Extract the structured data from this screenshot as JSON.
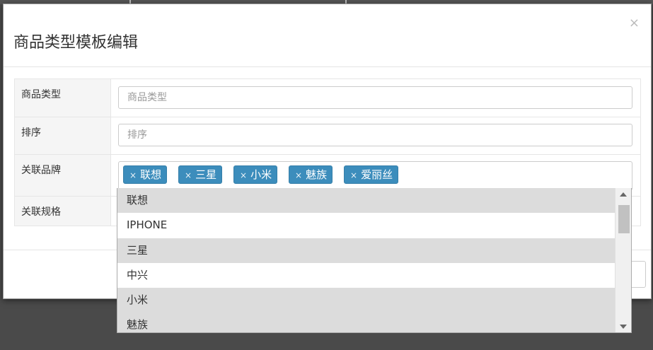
{
  "modal": {
    "title": "商品类型模板编辑",
    "close_icon": "×"
  },
  "form": {
    "type_label": "商品类型",
    "type_placeholder": "商品类型",
    "sort_label": "排序",
    "sort_placeholder": "排序",
    "brand_label": "关联品牌",
    "spec_label": "关联规格"
  },
  "brand_tags": [
    {
      "remove": "×",
      "label": "联想"
    },
    {
      "remove": "×",
      "label": "三星"
    },
    {
      "remove": "×",
      "label": "小米"
    },
    {
      "remove": "×",
      "label": "魅族"
    },
    {
      "remove": "×",
      "label": "爱丽丝"
    }
  ],
  "brand_options": [
    {
      "label": "联想",
      "selected": true
    },
    {
      "label": "IPHONE",
      "selected": false
    },
    {
      "label": "三星",
      "selected": true
    },
    {
      "label": "中兴",
      "selected": false
    },
    {
      "label": "小米",
      "selected": true
    },
    {
      "label": "魅族",
      "selected": true
    }
  ],
  "colors": {
    "tag_bg": "#3c8dbc",
    "selected_option_bg": "#dcdcdc",
    "backdrop": "#4a4a4a"
  }
}
